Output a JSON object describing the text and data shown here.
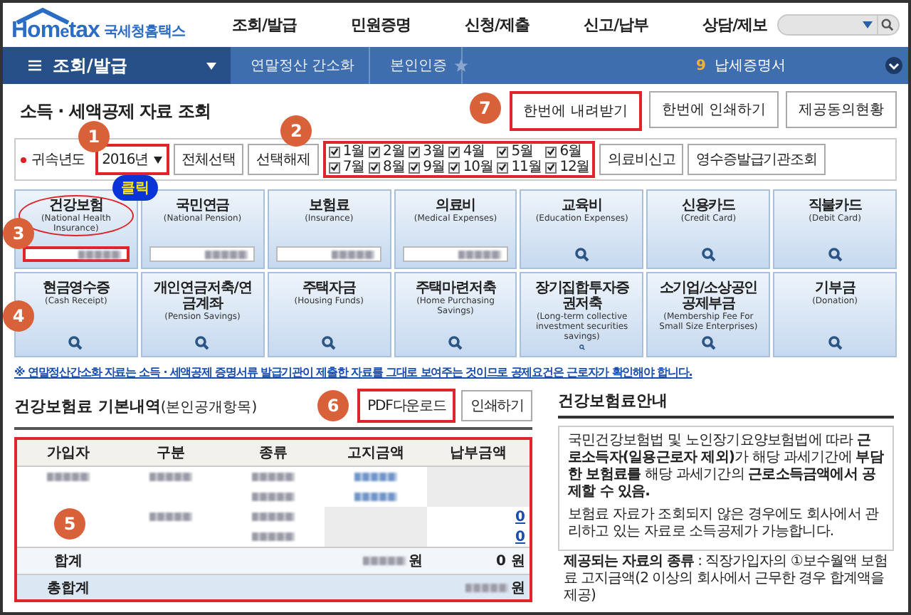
{
  "logo": {
    "brand_left": "Hom",
    "brand_e": "e",
    "brand_right": "tax",
    "tagline": "국세청홈택스"
  },
  "nav": [
    "조회/발급",
    "민원증명",
    "신청/제출",
    "신고/납부",
    "상담/제보"
  ],
  "breadcrumb": {
    "menu": "조회/발급",
    "items": [
      "연말정산 간소화",
      "본인인증"
    ],
    "count": "9",
    "link": "납세증명서"
  },
  "page_title": "소득 · 세액공제 자료 조회",
  "top_buttons": [
    {
      "label": "한번에 내려받기",
      "highlighted": true,
      "badge": "7"
    },
    {
      "label": "한번에 인쇄하기",
      "highlighted": false
    },
    {
      "label": "제공동의현황",
      "highlighted": false
    }
  ],
  "filter": {
    "label": "귀속년도",
    "year": "2016년",
    "year_badge": "1",
    "buttons": [
      "전체선택",
      "선택해제"
    ],
    "months_badge": "2",
    "months": [
      {
        "label": "1월",
        "checked": true
      },
      {
        "label": "2월",
        "checked": true
      },
      {
        "label": "3월",
        "checked": true
      },
      {
        "label": "4월",
        "checked": true
      },
      {
        "label": "5월",
        "checked": true
      },
      {
        "label": "6월",
        "checked": true
      },
      {
        "label": "7월",
        "checked": true
      },
      {
        "label": "8월",
        "checked": true
      },
      {
        "label": "9월",
        "checked": true
      },
      {
        "label": "10월",
        "checked": true
      },
      {
        "label": "11월",
        "checked": true
      },
      {
        "label": "12월",
        "checked": true
      }
    ],
    "right_buttons": [
      "의료비신고",
      "영수증발급기관조회"
    ]
  },
  "tiles": [
    {
      "title": "건강보험",
      "subtitle": "(National Health Insurance)",
      "kind": "amount",
      "highlighted": true,
      "badge": "3",
      "callout": "클릭"
    },
    {
      "title": "국민연금",
      "subtitle": "(National Pension)",
      "kind": "amount",
      "highlighted": false
    },
    {
      "title": "보험료",
      "subtitle": "(Insurance)",
      "kind": "amount",
      "highlighted": false
    },
    {
      "title": "의료비",
      "subtitle": "(Medical Expenses)",
      "kind": "amount",
      "highlighted": false
    },
    {
      "title": "교육비",
      "subtitle": "(Education Expenses)",
      "kind": "search",
      "highlighted": false
    },
    {
      "title": "신용카드",
      "subtitle": "(Credit Card)",
      "kind": "search",
      "highlighted": false
    },
    {
      "title": "직불카드",
      "subtitle": "(Debit Card)",
      "kind": "search",
      "highlighted": false
    },
    {
      "title": "현금영수증",
      "subtitle": "(Cash Receipt)",
      "kind": "search",
      "highlighted": false,
      "badge": "4"
    },
    {
      "title": "개인연금저축/연금계좌",
      "subtitle": "(Pension Savings)",
      "kind": "search",
      "highlighted": false
    },
    {
      "title": "주택자금",
      "subtitle": "(Housing Funds)",
      "kind": "search",
      "highlighted": false
    },
    {
      "title": "주택마련저축",
      "subtitle": "(Home Purchasing Savings)",
      "kind": "search",
      "highlighted": false
    },
    {
      "title": "장기집합투자증권저축",
      "subtitle": "(Long-term collective investment securities savings)",
      "kind": "search",
      "highlighted": false
    },
    {
      "title": "소기업/소상공인 공제부금",
      "subtitle": "(Membership Fee For Small Size Enterprises)",
      "kind": "search",
      "highlighted": false
    },
    {
      "title": "기부금",
      "subtitle": "(Donation)",
      "kind": "search",
      "highlighted": false
    }
  ],
  "notice": "※ 연말정산간소화 자료는 소득 · 세액공제 증명서류 발급기관이 제출한 자료를 그대로 보여주는 것이므로 공제요건은 근로자가 확인해야 합니다.",
  "section": {
    "title": "건강보험료 기본내역",
    "note": "(본인공개항목)",
    "buttons": [
      {
        "label": "PDF다운로드",
        "highlighted": true,
        "badge": "6"
      },
      {
        "label": "인쇄하기",
        "highlighted": false
      }
    ]
  },
  "table": {
    "badge": "5",
    "columns": [
      "가입자",
      "구분",
      "종류",
      "고지금액",
      "납부금액"
    ],
    "rows": [
      {
        "kind": "data",
        "cells": [
          {
            "kind": "blur"
          },
          {
            "kind": "blur"
          },
          {
            "kind": "blur"
          },
          {
            "kind": "blur",
            "link": true
          },
          {
            "kind": "shaded"
          }
        ]
      },
      {
        "kind": "data",
        "cells": [
          {
            "kind": "empty"
          },
          {
            "kind": "empty"
          },
          {
            "kind": "blur"
          },
          {
            "kind": "blur",
            "link": true
          },
          {
            "kind": "shaded"
          }
        ]
      },
      {
        "kind": "data",
        "cells": [
          {
            "kind": "empty"
          },
          {
            "kind": "blur"
          },
          {
            "kind": "blur"
          },
          {
            "kind": "shaded"
          },
          {
            "kind": "link",
            "text": "0"
          }
        ]
      },
      {
        "kind": "data",
        "cells": [
          {
            "kind": "empty"
          },
          {
            "kind": "empty"
          },
          {
            "kind": "blur"
          },
          {
            "kind": "shaded"
          },
          {
            "kind": "link",
            "text": "0"
          }
        ]
      },
      {
        "kind": "total",
        "cells": [
          {
            "kind": "text",
            "text": "합계"
          },
          {
            "kind": "empty"
          },
          {
            "kind": "empty"
          },
          {
            "kind": "blur",
            "text": "원"
          },
          {
            "kind": "text",
            "text": "0 원"
          }
        ]
      },
      {
        "kind": "grand_total",
        "cells": [
          {
            "kind": "text",
            "text": "총합계"
          },
          {
            "kind": "empty"
          },
          {
            "kind": "empty"
          },
          {
            "kind": "empty"
          },
          {
            "kind": "blur",
            "text": "원"
          }
        ]
      }
    ]
  },
  "guide": {
    "title": "건강보험료안내",
    "paragraphs": [
      "국민건강보험법 및 노인장기요양보험법에 따라 **근로소득자(일용근로자 제외)**가 해당 과세기간에 **부담한 보험료를** 해당 과세기간의 **근로소득금액에서 공제할 수 있음.**",
      "보험료 자료가 조회되지 않은 경우에도 회사에서 관리하고 있는 자료로 소득공제가 가능합니다."
    ],
    "bullet": {
      "label": "제공되는 자료의 종류",
      "text": " : 직장가입자의 ①보수월액 보험료 고지금액(2 이상의 회사에서 근무한 경우 합계액을 제공)"
    }
  }
}
